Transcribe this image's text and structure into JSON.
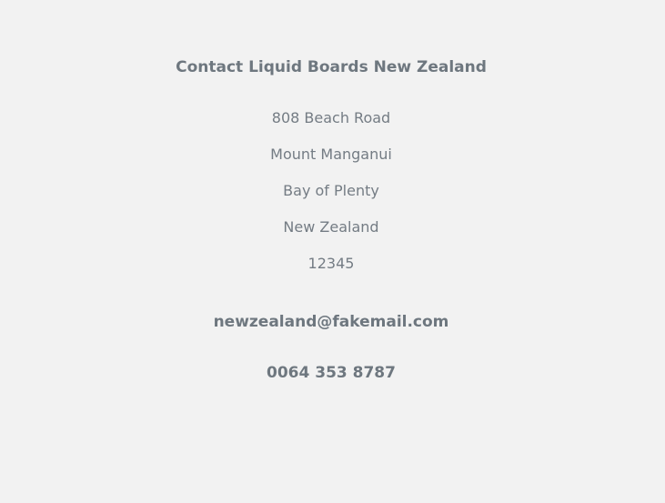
{
  "contact": {
    "title": "Contact Liquid Boards New Zealand",
    "address": {
      "street": "808 Beach Road",
      "suburb": "Mount Manganui",
      "region": "Bay of Plenty",
      "country": "New Zealand",
      "postcode": "12345"
    },
    "email": "newzealand@fakemail.com",
    "phone": "0064 353 8787"
  }
}
